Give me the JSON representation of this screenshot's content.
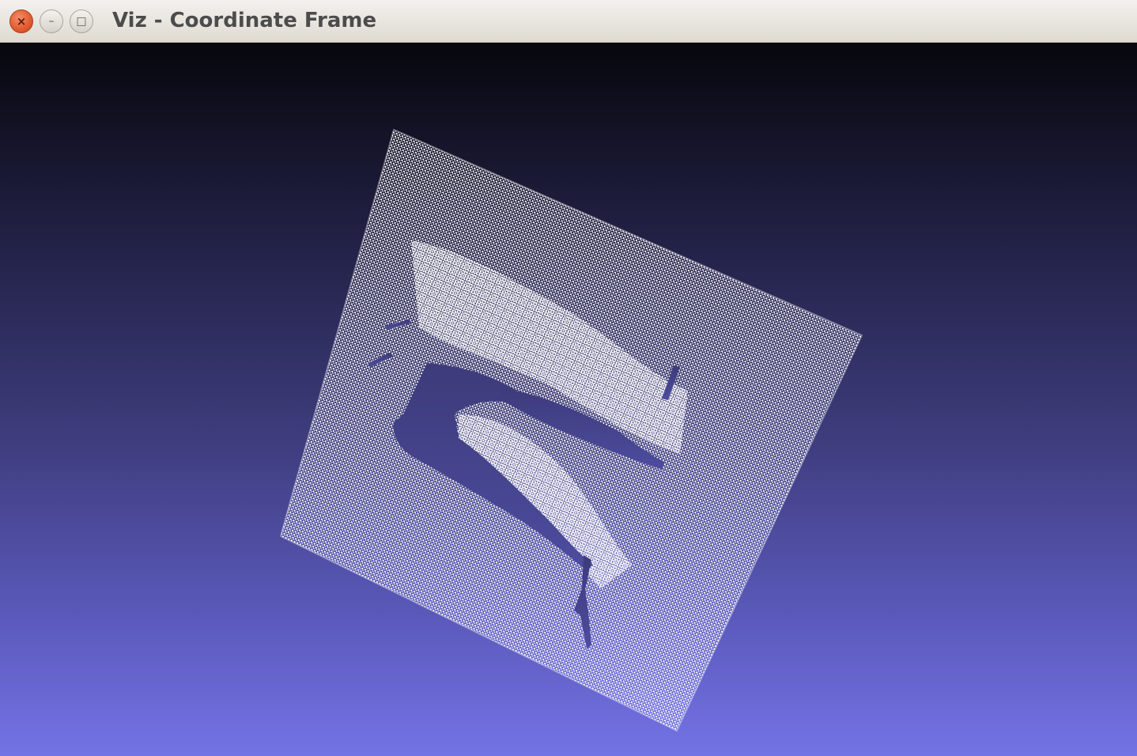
{
  "window": {
    "title": "Viz - Coordinate Frame",
    "close_glyph": "×",
    "minimize_glyph": "–",
    "maximize_glyph": "□"
  },
  "icons": {
    "close": "close-icon",
    "minimize": "minimize-icon",
    "maximize": "maximize-icon"
  },
  "colors": {
    "background_top": "#07070d",
    "background_bottom": "#7473e5",
    "point_cloud": "#ffffff",
    "close_button": "#e05a2d"
  }
}
